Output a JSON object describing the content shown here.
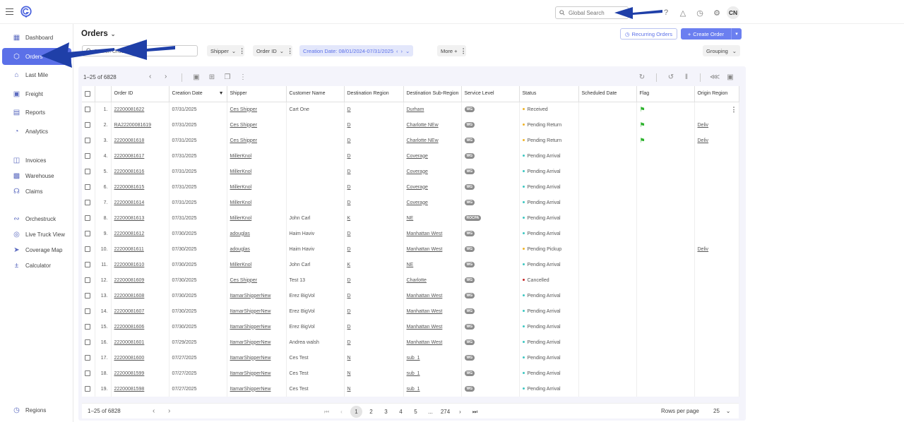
{
  "app": {
    "user_initials": "CN"
  },
  "search": {
    "global_placeholder": "Global Search",
    "orders_placeholder": "Search Orders"
  },
  "sidebar": {
    "items": [
      {
        "label": "Dashboard",
        "icon": "dashboard-icon",
        "active": false
      },
      {
        "label": "Orders",
        "icon": "box-icon",
        "active": true
      },
      {
        "label": "Last Mile",
        "icon": "home-icon",
        "active": false
      },
      {
        "label": "Freight",
        "icon": "truck-icon",
        "active": false
      },
      {
        "label": "Reports",
        "icon": "report-icon",
        "active": false
      },
      {
        "label": "Analytics",
        "icon": "analytics-icon",
        "active": false
      },
      {
        "label": "Invoices",
        "icon": "invoice-icon",
        "active": false
      },
      {
        "label": "Warehouse",
        "icon": "warehouse-icon",
        "active": false
      },
      {
        "label": "Claims",
        "icon": "headset-icon",
        "active": false
      },
      {
        "label": "Orchestruck",
        "icon": "route-icon",
        "active": false
      },
      {
        "label": "Live Truck View",
        "icon": "target-icon",
        "active": false
      },
      {
        "label": "Coverage Map",
        "icon": "navigation-icon",
        "active": false
      },
      {
        "label": "Calculator",
        "icon": "calculator-icon",
        "active": false
      },
      {
        "label": "Regions",
        "icon": "globe-icon",
        "active": false
      }
    ]
  },
  "header": {
    "title": "Orders",
    "recurring_label": "Recurring Orders",
    "create_label": "Create Order"
  },
  "filters": {
    "chips": [
      "Shipper",
      "Order ID",
      "Creation Date: 08/01/2024-07/31/2025",
      "More +"
    ],
    "grouping": "Grouping"
  },
  "grid": {
    "range_label": "1–25 of 6828",
    "columns": [
      "Order ID",
      "Creation Date",
      "Shipper",
      "Customer Name",
      "Destination Region",
      "Destination Sub-Region",
      "Service Level",
      "Status",
      "Scheduled Date",
      "Flag",
      "Origin Region"
    ],
    "rows": [
      {
        "n": "1.",
        "id": "22200081622",
        "date": "07/31/2025",
        "shipper": "Ces Shipper",
        "customer": "Cart One",
        "dest": "D",
        "sub": "Durham",
        "svc": "WG",
        "status": "Received",
        "status_color": "#f0b429",
        "flag": true,
        "origin": ""
      },
      {
        "n": "2.",
        "id": "RA22200081619",
        "date": "07/31/2025",
        "shipper": "Ces Shipper",
        "customer": "",
        "dest": "D",
        "sub": "Charlotte NEw",
        "svc": "WG",
        "status": "Pending Return",
        "status_color": "#f0b429",
        "flag": true,
        "origin": "Deliv"
      },
      {
        "n": "3.",
        "id": "22200081618",
        "date": "07/31/2025",
        "shipper": "Ces Shipper",
        "customer": "",
        "dest": "D",
        "sub": "Charlotte NEw",
        "svc": "WG",
        "status": "Pending Return",
        "status_color": "#f0b429",
        "flag": true,
        "origin": "Deliv"
      },
      {
        "n": "4.",
        "id": "22200081617",
        "date": "07/31/2025",
        "shipper": "MillerKnol",
        "customer": "",
        "dest": "D",
        "sub": "Coverage",
        "svc": "WG",
        "status": "Pending Arrival",
        "status_color": "#3ec7c2",
        "flag": false,
        "origin": ""
      },
      {
        "n": "5.",
        "id": "22200081616",
        "date": "07/31/2025",
        "shipper": "MillerKnol",
        "customer": "",
        "dest": "D",
        "sub": "Coverage",
        "svc": "WG",
        "status": "Pending Arrival",
        "status_color": "#3ec7c2",
        "flag": false,
        "origin": ""
      },
      {
        "n": "6.",
        "id": "22200081615",
        "date": "07/31/2025",
        "shipper": "MillerKnol",
        "customer": "",
        "dest": "D",
        "sub": "Coverage",
        "svc": "WG",
        "status": "Pending Arrival",
        "status_color": "#3ec7c2",
        "flag": false,
        "origin": ""
      },
      {
        "n": "7.",
        "id": "22200081614",
        "date": "07/31/2025",
        "shipper": "MillerKnol",
        "customer": "",
        "dest": "D",
        "sub": "Coverage",
        "svc": "WG",
        "status": "Pending Arrival",
        "status_color": "#3ec7c2",
        "flag": false,
        "origin": ""
      },
      {
        "n": "8.",
        "id": "22200081613",
        "date": "07/31/2025",
        "shipper": "MillerKnol",
        "customer": "John Carl",
        "dest": "K",
        "sub": "NE",
        "svc": "ROCPA",
        "status": "Pending Arrival",
        "status_color": "#3ec7c2",
        "flag": false,
        "origin": ""
      },
      {
        "n": "9.",
        "id": "22200081612",
        "date": "07/30/2025",
        "shipper": "adouglas",
        "customer": "Haim Haviv",
        "dest": "D",
        "sub": "Manhattan West",
        "svc": "WG",
        "status": "Pending Arrival",
        "status_color": "#3ec7c2",
        "flag": false,
        "origin": ""
      },
      {
        "n": "10.",
        "id": "22200081611",
        "date": "07/30/2025",
        "shipper": "adouglas",
        "customer": "Haim Haviv",
        "dest": "D",
        "sub": "Manhattan West",
        "svc": "WG",
        "status": "Pending Pickup",
        "status_color": "#f0b429",
        "flag": false,
        "origin": "Deliv"
      },
      {
        "n": "11.",
        "id": "22200081610",
        "date": "07/30/2025",
        "shipper": "MillerKnol",
        "customer": "John Carl",
        "dest": "K",
        "sub": "NE",
        "svc": "WG",
        "status": "Pending Arrival",
        "status_color": "#3ec7c2",
        "flag": false,
        "origin": ""
      },
      {
        "n": "12.",
        "id": "22200081609",
        "date": "07/30/2025",
        "shipper": "Ces Shipper",
        "customer": "Test 13",
        "dest": "D",
        "sub": "Charlotte",
        "svc": "WG",
        "status": "Cancelled",
        "status_color": "#c62828",
        "flag": false,
        "origin": ""
      },
      {
        "n": "13.",
        "id": "22200081608",
        "date": "07/30/2025",
        "shipper": "ItamarShipperNew",
        "customer": "Erez BigVol",
        "dest": "D",
        "sub": "Manhattan West",
        "svc": "WG",
        "status": "Pending Arrival",
        "status_color": "#3ec7c2",
        "flag": false,
        "origin": ""
      },
      {
        "n": "14.",
        "id": "22200081607",
        "date": "07/30/2025",
        "shipper": "ItamarShipperNew",
        "customer": "Erez BigVol",
        "dest": "D",
        "sub": "Manhattan West",
        "svc": "WG",
        "status": "Pending Arrival",
        "status_color": "#3ec7c2",
        "flag": false,
        "origin": ""
      },
      {
        "n": "15.",
        "id": "22200081606",
        "date": "07/30/2025",
        "shipper": "ItamarShipperNew",
        "customer": "Erez BigVol",
        "dest": "D",
        "sub": "Manhattan West",
        "svc": "WG",
        "status": "Pending Arrival",
        "status_color": "#3ec7c2",
        "flag": false,
        "origin": ""
      },
      {
        "n": "16.",
        "id": "22200081601",
        "date": "07/29/2025",
        "shipper": "ItamarShipperNew",
        "customer": "Andrea walsh",
        "dest": "D",
        "sub": "Manhattan West",
        "svc": "WG",
        "status": "Pending Arrival",
        "status_color": "#3ec7c2",
        "flag": false,
        "origin": ""
      },
      {
        "n": "17.",
        "id": "22200081600",
        "date": "07/27/2025",
        "shipper": "ItamarShipperNew",
        "customer": "Ces Test",
        "dest": "N",
        "sub": "sub_1",
        "svc": "WG",
        "status": "Pending Arrival",
        "status_color": "#3ec7c2",
        "flag": false,
        "origin": ""
      },
      {
        "n": "18.",
        "id": "22200081599",
        "date": "07/27/2025",
        "shipper": "ItamarShipperNew",
        "customer": "Ces Test",
        "dest": "N",
        "sub": "sub_1",
        "svc": "WG",
        "status": "Pending Arrival",
        "status_color": "#3ec7c2",
        "flag": false,
        "origin": ""
      },
      {
        "n": "19.",
        "id": "22200081598",
        "date": "07/27/2025",
        "shipper": "ItamarShipperNew",
        "customer": "Ces Test",
        "dest": "N",
        "sub": "sub_1",
        "svc": "WG",
        "status": "Pending Arrival",
        "status_color": "#3ec7c2",
        "flag": false,
        "origin": ""
      }
    ]
  },
  "footer": {
    "range_label": "1–25 of 6828",
    "pages": [
      "1",
      "2",
      "3",
      "4",
      "5",
      "...",
      "274"
    ],
    "current_page": "1",
    "rows_per_page_label": "Rows per page",
    "rows_per_page_value": "25"
  },
  "colors": {
    "accent": "#5b70e8",
    "annotation_arrow": "#1f3fa8",
    "flag": "#2db22d"
  }
}
